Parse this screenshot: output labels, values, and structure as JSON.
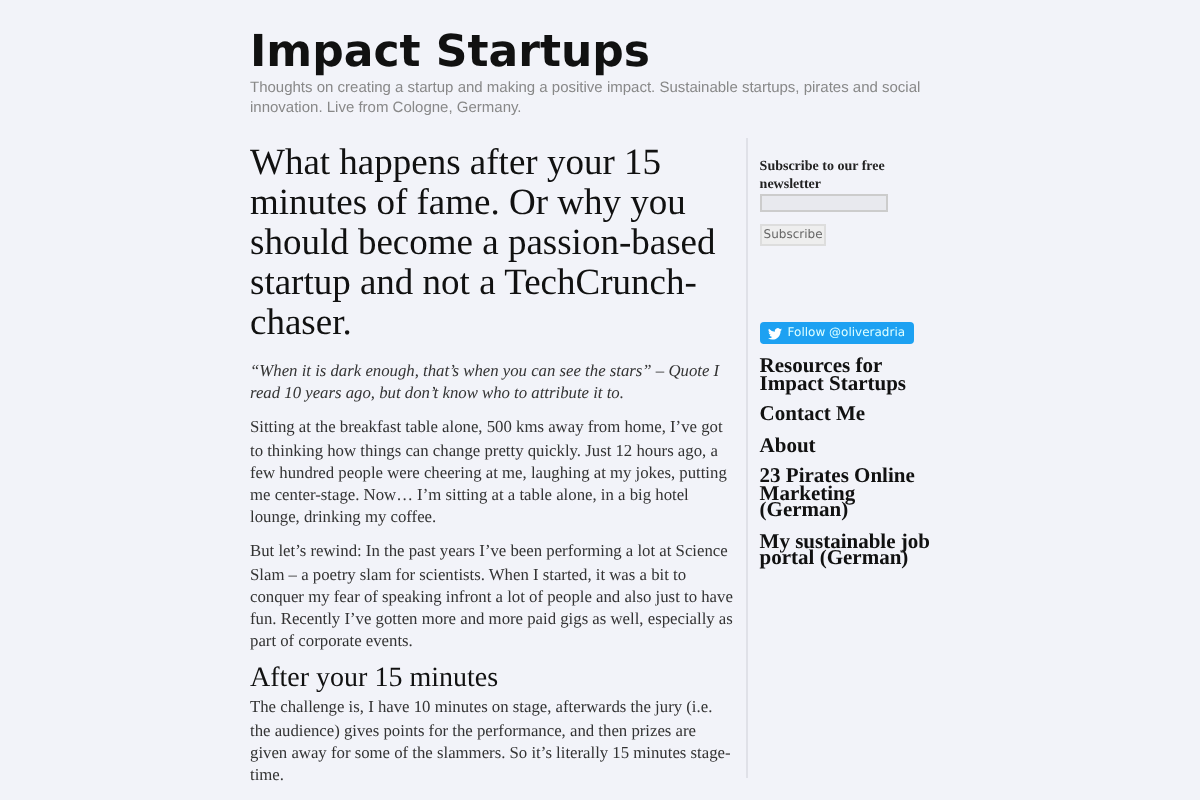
{
  "site": {
    "title": "Impact Startups",
    "tagline": "Thoughts on creating a startup and making a positive impact. Sustainable startups, pirates and social innovation. Live from Cologne, Germany."
  },
  "article": {
    "title": "What happens after your 15 minutes of fame. Or why you should become a passion-based startup and not a TechCrunch-chaser.",
    "blocks": [
      {
        "kind": "quote",
        "text": "“When it is dark enough, that’s when you can see the stars” – Quote I read 10 years ago, but don’t know who to attribute it to."
      },
      {
        "kind": "paragraph",
        "text": "Sitting at the breakfast table alone, 500 kms away from home, I’ve got to thinking how things can change pretty quickly. Just 12 hours ago, a few hundred people were cheering at me, laughing at my jokes, putting me center-stage. Now… I’m sitting at a table alone, in a big hotel lounge, drinking my coffee."
      },
      {
        "kind": "paragraph",
        "text": "But let’s rewind: In the past years I’ve been performing a lot at Science Slam – a poetry slam for scientists. When I started, it was a bit to conquer my fear of speaking infront a lot of people and also just to have fun. Recently I’ve gotten more and more paid gigs as well, especially as part of corporate events."
      },
      {
        "kind": "heading",
        "text": "After your 15 minutes"
      },
      {
        "kind": "paragraph",
        "text": "The challenge is, I have 10 minutes on stage, afterwards the jury (i.e. the audience) gives points for the performance, and then prizes are given away for some of the slammers. So it’s literally 15 minutes stage-time."
      }
    ]
  },
  "sidebar": {
    "newsletter": {
      "label": "Subscribe to our free newsletter",
      "button": "Subscribe"
    },
    "follow_button": "Follow @oliveradria",
    "links": [
      "Resources for Impact Startups",
      "Contact Me",
      "About",
      "23 Pirates Online Marketing (German)",
      "My sustainable job portal (German)"
    ]
  }
}
